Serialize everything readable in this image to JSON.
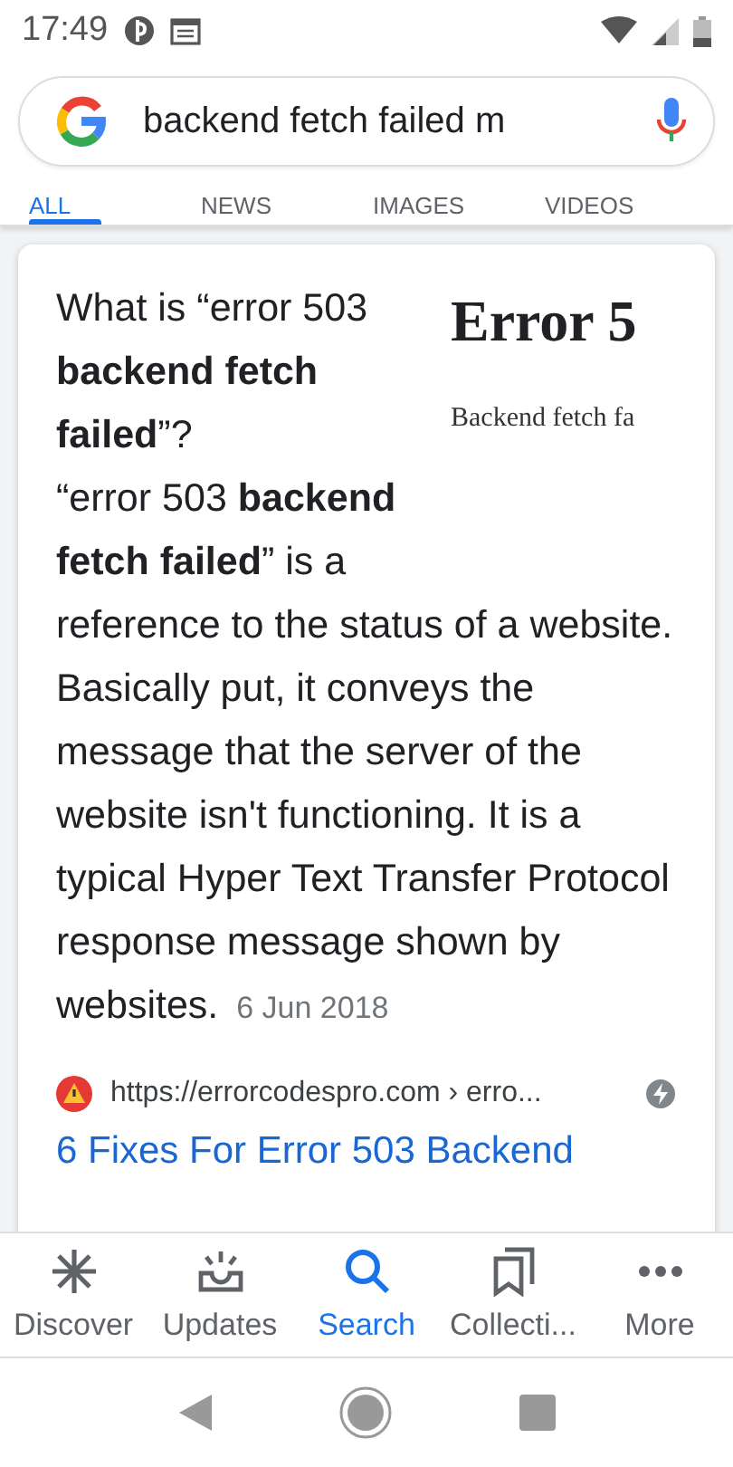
{
  "status_bar": {
    "time": "17:49"
  },
  "search": {
    "value": "backend fetch failed m"
  },
  "tabs": [
    {
      "label": "ALL",
      "selected": true
    },
    {
      "label": "NEWS",
      "selected": false
    },
    {
      "label": "IMAGES",
      "selected": false
    },
    {
      "label": "VIDEOS",
      "selected": false
    }
  ],
  "result": {
    "heading": "What is “error 503 **backend fetch failed**”?",
    "thumbnail": {
      "title": "Error 5",
      "subtitle": "Backend fetch fa"
    },
    "body": "“error 503 **backend fetch failed**” is a reference to the status of a website. Basically put, it conveys the message that the server of the website isn't functioning. It is a typical Hyper Text Transfer Protocol response message shown by websites.",
    "date": "6 Jun 2018",
    "source": "https://errorcodespro.com › erro...",
    "link": "6 Fixes For Error 503 Backend"
  },
  "bottom_nav": [
    {
      "kind": "discover",
      "label": "Discover",
      "selected": false
    },
    {
      "kind": "updates",
      "label": "Updates",
      "selected": false
    },
    {
      "kind": "search",
      "label": "Search",
      "selected": true
    },
    {
      "kind": "collections",
      "label": "Collecti...",
      "selected": false
    },
    {
      "kind": "more",
      "label": "More",
      "selected": false
    }
  ]
}
